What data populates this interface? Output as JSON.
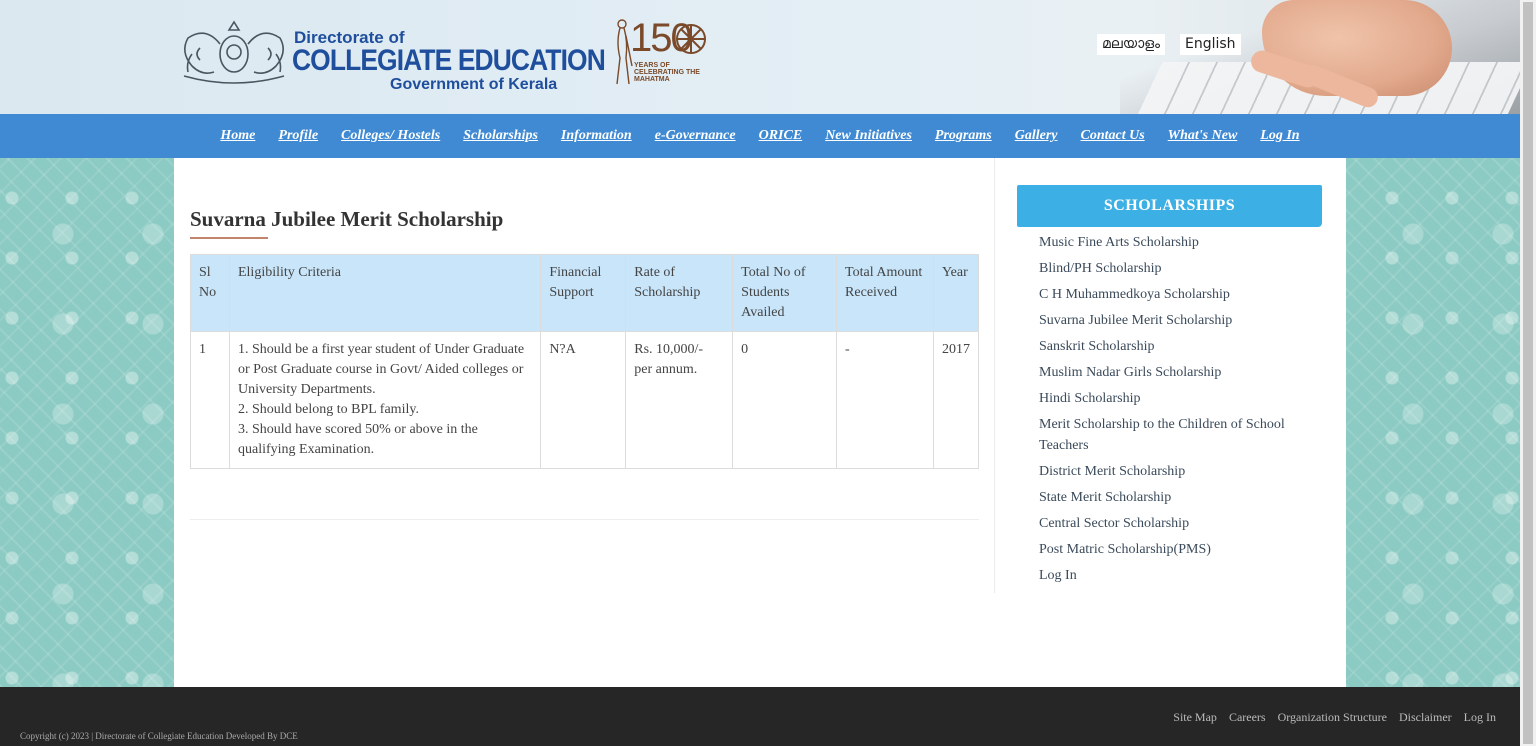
{
  "header": {
    "logo": {
      "line1": "Directorate of",
      "line2": "COLLEGIATE EDUCATION",
      "line3": "Government of Kerala"
    },
    "badge": {
      "number": "150",
      "subtitle": "YEARS OF CELEBRATING THE MAHATMA"
    },
    "languages": [
      "മലയാളം",
      "English"
    ]
  },
  "nav": {
    "items": [
      "Home",
      "Profile",
      "Colleges/ Hostels",
      "Scholarships",
      "Information",
      "e-Governance",
      "ORICE",
      "New Initiatives",
      "Programs",
      "Gallery",
      "Contact Us",
      "What's New",
      "Log In"
    ]
  },
  "main": {
    "title": "Suvarna Jubilee Merit Scholarship",
    "table": {
      "headers": [
        "Sl No",
        "Eligibility Criteria",
        "Financial Support",
        "Rate of Scholarship",
        "Total No of Students Availed",
        "Total Amount Received",
        "Year"
      ],
      "rows": [
        {
          "sl": "1",
          "criteria": [
            "1. Should be a first year student of Under Graduate or Post Graduate course in Govt/ Aided colleges or University Departments.",
            "2. Should belong to BPL family.",
            "3. Should have scored 50% or above in the qualifying Examination."
          ],
          "support": "N?A",
          "rate": "Rs. 10,000/- per annum.",
          "students": "0",
          "amount": "-",
          "year": "2017"
        }
      ]
    }
  },
  "sidebar": {
    "heading": "SCHOLARSHIPS",
    "items": [
      "Music Fine Arts Scholarship",
      "Blind/PH Scholarship",
      "C H Muhammedkoya Scholarship",
      "Suvarna Jubilee Merit Scholarship",
      "Sanskrit Scholarship",
      "Muslim Nadar Girls Scholarship",
      "Hindi Scholarship",
      "Merit Scholarship to the Children of School Teachers",
      "District Merit Scholarship",
      "State Merit Scholarship",
      "Central Sector Scholarship",
      "Post Matric Scholarship(PMS)",
      "Log In"
    ]
  },
  "footer": {
    "links": [
      "Site Map",
      "Careers",
      "Organization Structure",
      "Disclaimer",
      "Log In"
    ],
    "copyright": "Copyright (c) 2023 | Directorate of Collegiate Education Developed By DCE"
  }
}
